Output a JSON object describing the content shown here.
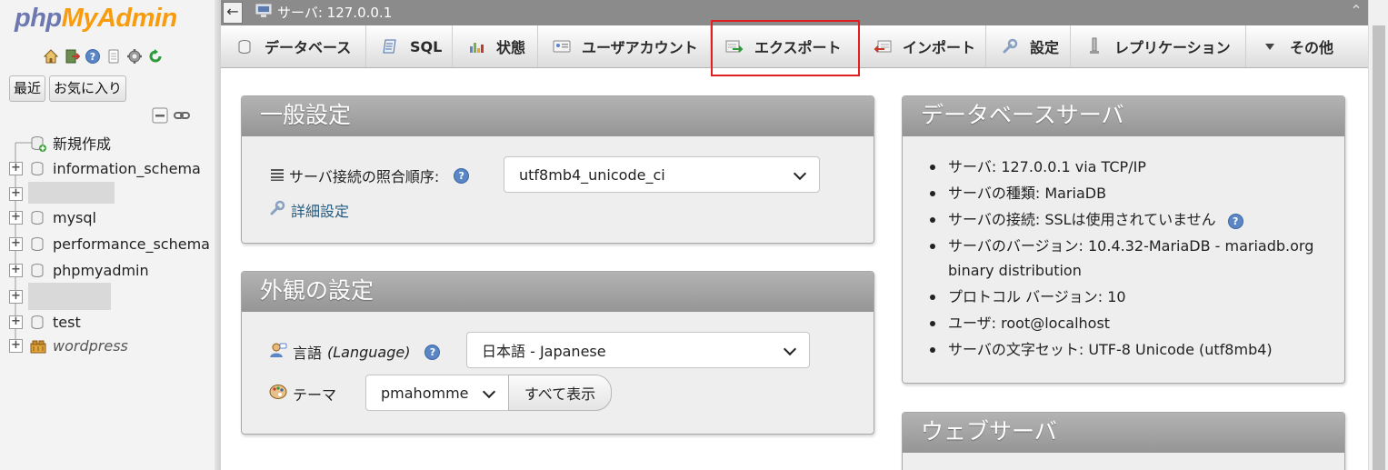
{
  "nav": {
    "logo_php": "php",
    "logo_myadmin": "MyAdmin",
    "icons": [
      "home-icon",
      "exit-icon",
      "help-icon",
      "docs-icon",
      "settings-icon",
      "reload-icon"
    ],
    "tabs": [
      "最近",
      "お気に入り"
    ],
    "tools": [
      "collapse-all-icon",
      "link-icon"
    ],
    "tree": {
      "new_label": "新規作成",
      "databases": [
        {
          "name": "information_schema",
          "italic": false
        },
        {
          "name": "",
          "redacted": true
        },
        {
          "name": "mysql",
          "italic": false
        },
        {
          "name": "performance_schema",
          "italic": false
        },
        {
          "name": "phpmyadmin",
          "italic": false
        },
        {
          "name": "",
          "redacted": true
        },
        {
          "name": "test",
          "italic": false
        },
        {
          "name": "wordpress",
          "italic": true
        }
      ]
    }
  },
  "topbar": {
    "back": "←",
    "server_label": "サーバ: 127.0.0.1",
    "collapse": "⌃"
  },
  "menu": {
    "tabs": [
      {
        "label": "データベース",
        "icon": "database-icon"
      },
      {
        "label": "SQL",
        "icon": "sql-icon"
      },
      {
        "label": "状態",
        "icon": "status-icon"
      },
      {
        "label": "ユーザアカウント",
        "icon": "users-icon"
      },
      {
        "label": "エクスポート",
        "icon": "export-icon"
      },
      {
        "label": "インポート",
        "icon": "import-icon"
      },
      {
        "label": "設定",
        "icon": "wrench-icon"
      },
      {
        "label": "レプリケーション",
        "icon": "replication-icon"
      },
      {
        "label": "その他",
        "icon": "caret-down-icon"
      }
    ],
    "highlighted_tab": "エクスポート"
  },
  "general": {
    "title": "一般設定",
    "collation_label": "サーバ接続の照合順序:",
    "collation_value": "utf8mb4_unicode_ci",
    "more_settings": "詳細設定"
  },
  "appearance": {
    "title": "外観の設定",
    "language_label": "言語",
    "language_en": "(Language)",
    "language_value": "日本語 - Japanese",
    "theme_label": "テーマ",
    "theme_value": "pmahomme",
    "show_all": "すべて表示"
  },
  "dbserver": {
    "title": "データベースサーバ",
    "items": [
      "サーバ: 127.0.0.1 via TCP/IP",
      "サーバの種類: MariaDB",
      "サーバの接続: SSLは使用されていません",
      "サーバのバージョン: 10.4.32-MariaDB - mariadb.org binary distribution",
      "プロトコル バージョン: 10",
      "ユーザ: root@localhost",
      "サーバの文字セット: UTF-8 Unicode (utf8mb4)"
    ]
  },
  "webserver": {
    "title": "ウェブサーバ"
  },
  "colors": {
    "highlight": "#e02020",
    "panel_header": "#a3a3a3",
    "logo_blue": "#6c78af",
    "logo_orange": "#f89c0e"
  }
}
